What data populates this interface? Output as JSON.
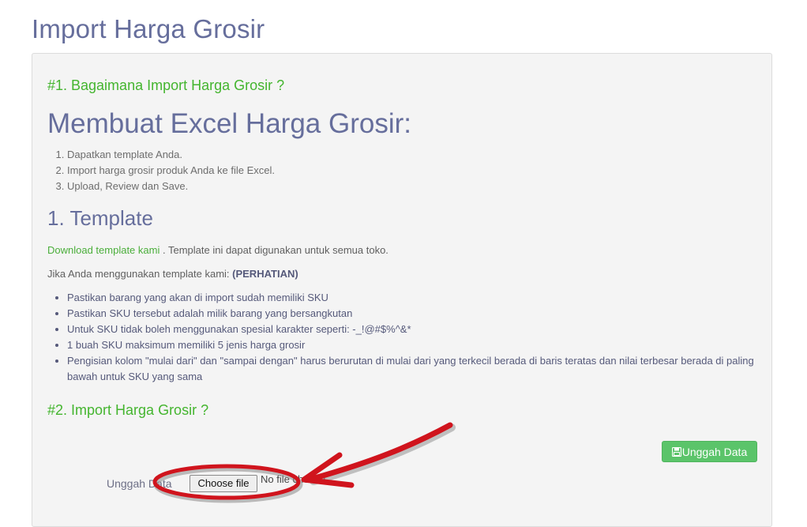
{
  "page": {
    "title": "Import Harga Grosir"
  },
  "section1": {
    "heading": "#1. Bagaimana Import Harga Grosir ?",
    "subheading": "Membuat Excel Harga Grosir:",
    "steps": [
      "Dapatkan template Anda.",
      "Import harga grosir produk Anda ke file Excel.",
      "Upload, Review dan Save."
    ]
  },
  "template": {
    "heading": "1. Template",
    "download_link": "Download template kami",
    "download_note": " . Template ini dapat digunakan untuk semua toko.",
    "notice_prefix": "Jika Anda menggunakan template kami: ",
    "notice_strong": "(PERHATIAN)",
    "rules": [
      "Pastikan barang yang akan di import sudah memiliki SKU",
      "Pastikan SKU tersebut adalah milik barang yang bersangkutan",
      "Untuk SKU tidak boleh menggunakan spesial karakter seperti: -_!@#$%^&*",
      "1 buah SKU maksimum memiliki 5 jenis harga grosir",
      "Pengisian kolom \"mulai dari\" dan \"sampai dengan\" harus berurutan di mulai dari yang terkecil berada di baris teratas dan nilai terbesar berada di paling bawah untuk SKU yang sama"
    ]
  },
  "section2": {
    "heading": "#2. Import Harga Grosir ?",
    "upload_button": "Unggah Data",
    "upload_label": "Unggah Data",
    "file_button": "Choose file",
    "file_status": "No file chosen"
  },
  "colors": {
    "heading": "#666e9c",
    "accent_green": "#44b52f",
    "button_green": "#5bc46a",
    "annotation_red": "#d0141d"
  },
  "icons": {
    "upload_button_icon": "save-icon"
  }
}
